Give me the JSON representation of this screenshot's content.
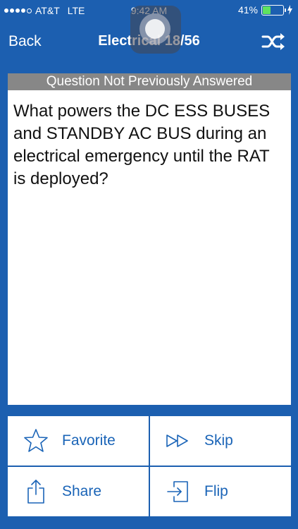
{
  "status_bar": {
    "carrier": "AT&T",
    "network": "LTE",
    "time": "9:42 AM",
    "battery": "41%",
    "battery_level": 0.41
  },
  "nav": {
    "back_label": "Back",
    "title": "Electrical 18/56",
    "shuffle_icon": "shuffle-icon"
  },
  "card": {
    "header": "Question Not Previously Answered",
    "question": "What powers the DC ESS BUSES and STANDBY AC BUS during an electrical emergency until the RAT is deployed?"
  },
  "actions": {
    "favorite": "Favorite",
    "skip": "Skip",
    "share": "Share",
    "flip": "Flip"
  },
  "colors": {
    "background": "#1c5fb0",
    "accent": "#1a64b7",
    "header_gray": "#878787"
  }
}
